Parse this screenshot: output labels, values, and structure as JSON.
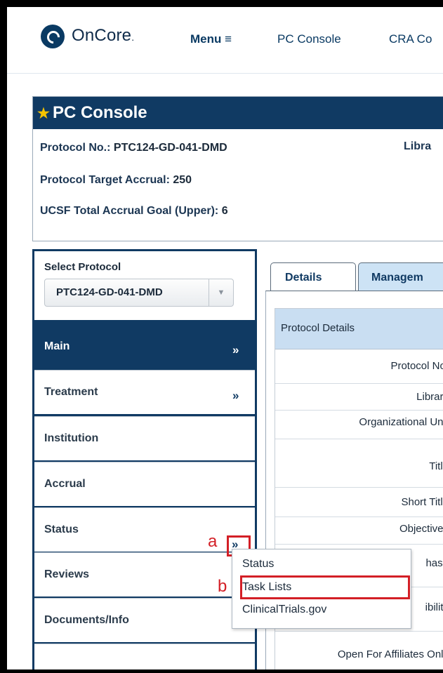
{
  "header": {
    "brand": "OnCore",
    "brand_dot": ".",
    "menu_label": "Menu ≡",
    "nav_items": [
      "PC Console",
      "CRA Co"
    ]
  },
  "console": {
    "title": "PC Console",
    "protocol_no_label": "Protocol No.:",
    "protocol_no_value": "PTC124-GD-041-DMD",
    "library_label": "Libra",
    "target_accrual_label": "Protocol Target Accrual:",
    "target_accrual_value": "250",
    "accrual_goal_label": "UCSF Total Accrual Goal (Upper):",
    "accrual_goal_value": "6"
  },
  "sidebar": {
    "select_label": "Select Protocol",
    "selected_protocol": "PTC124-GD-041-DMD",
    "items": [
      {
        "label": "Main",
        "chevron": "»"
      },
      {
        "label": "Treatment",
        "chevron": "»"
      },
      {
        "label": "Institution",
        "chevron": ""
      },
      {
        "label": "Accrual",
        "chevron": ""
      },
      {
        "label": "Status",
        "chevron": "»"
      },
      {
        "label": "Reviews",
        "chevron": ""
      },
      {
        "label": "Documents/Info",
        "chevron": "»"
      }
    ]
  },
  "popup": {
    "items": [
      "Status",
      "Task Lists",
      "ClinicalTrials.gov"
    ]
  },
  "callouts": {
    "a": "a",
    "b": "b"
  },
  "tabs": [
    "Details",
    "Managem"
  ],
  "details": {
    "header": "Protocol Details",
    "rows": [
      "Protocol No.",
      "Library",
      "Organizational Unit",
      "Title",
      "Short Title",
      "Objectives",
      "hase",
      "ibility",
      "Open For Affiliates Only"
    ]
  },
  "colors": {
    "navy": "#103a63",
    "highlight_red": "#d31f26",
    "tab_active_blue": "#cde3f5",
    "star_yellow": "#f6c400"
  }
}
